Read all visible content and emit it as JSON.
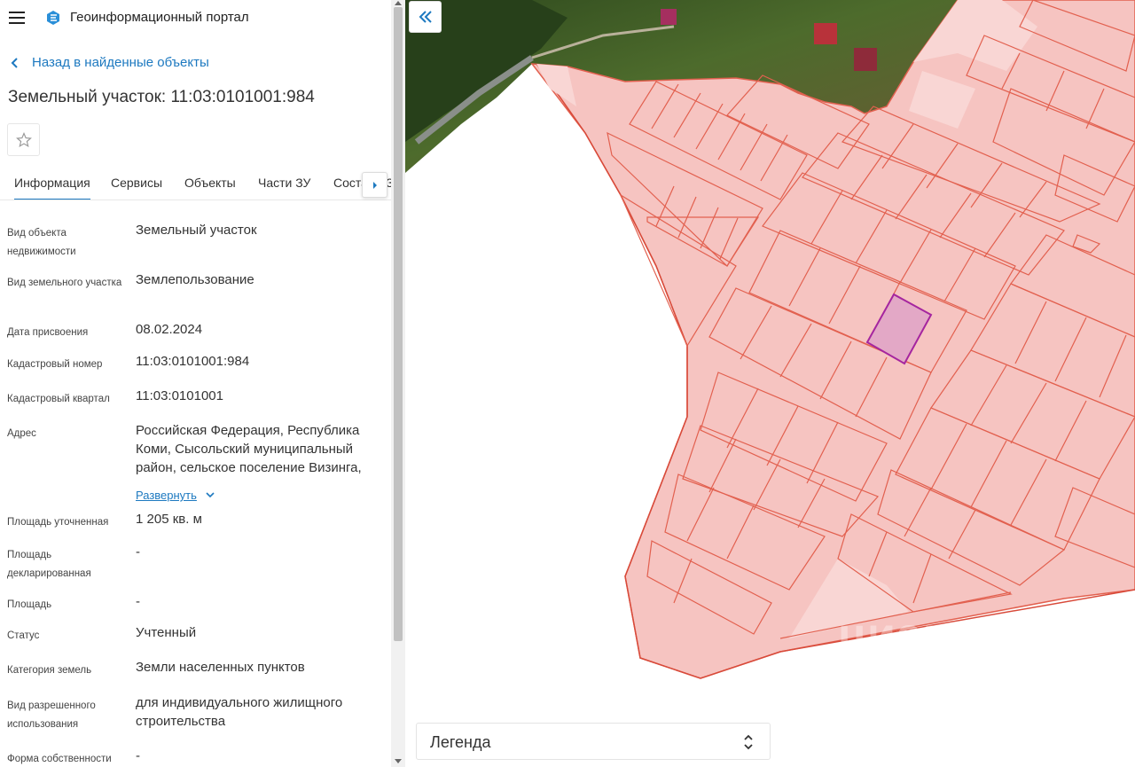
{
  "header": {
    "app_title": "Геоинформационный портал",
    "menu_icon": "hamburger-menu-icon",
    "logo_icon": "portal-logo-icon"
  },
  "nav": {
    "back_label": "Назад в найденные объекты"
  },
  "object": {
    "title": "Земельный участок: 11:03:0101001:984"
  },
  "tabs": [
    {
      "label": "Информация",
      "active": true
    },
    {
      "label": "Сервисы"
    },
    {
      "label": "Объекты"
    },
    {
      "label": "Части ЗУ"
    },
    {
      "label": "Состав ЕЗ"
    }
  ],
  "fields": [
    {
      "label": "Вид объекта недвижимости",
      "value": "Земельный участок"
    },
    {
      "label": "Вид земельного участка",
      "value": "Землепользование"
    },
    {
      "label": "Дата присвоения",
      "value": "08.02.2024"
    },
    {
      "label": "Кадастровый номер",
      "value": "11:03:0101001:984"
    },
    {
      "label": "Кадастровый квартал",
      "value": "11:03:0101001"
    },
    {
      "label": "Адрес",
      "value": "Российская Федерация, Республика Коми, Сысольский муниципальный район, сельское поселение Визинга,",
      "expand_label": "Развернуть"
    },
    {
      "label": "Площадь уточненная",
      "value": "1 205 кв. м"
    },
    {
      "label": "Площадь декларированная",
      "value": "-"
    },
    {
      "label": "Площадь",
      "value": "-"
    },
    {
      "label": "Статус",
      "value": "Учтенный"
    },
    {
      "label": "Категория земель",
      "value": "Земли населенных пунктов"
    },
    {
      "label": "Вид разрешенного использования",
      "value": "для индивидуального жилищного строительства"
    },
    {
      "label": "Форма собственности",
      "value": "-"
    }
  ],
  "map": {
    "legend_label": "Легенда",
    "watermark": "циан",
    "colors": {
      "parcel_fill": "#f6c4c1",
      "parcel_stroke": "#e2604f",
      "selected_fill": "#e3a8c6",
      "selected_stroke": "#a5259f",
      "accent": "#1d79c0"
    }
  }
}
